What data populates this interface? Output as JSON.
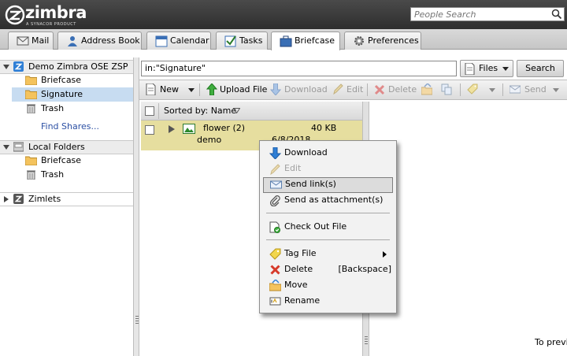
{
  "header": {
    "logo_word": "zimbra",
    "logo_sub": "A SYNACOR PRODUCT",
    "search_placeholder": "People Search"
  },
  "tabs": [
    {
      "label": "Mail",
      "icon": "mail-icon"
    },
    {
      "label": "Address Book",
      "icon": "address-book-icon"
    },
    {
      "label": "Calendar",
      "icon": "calendar-icon"
    },
    {
      "label": "Tasks",
      "icon": "tasks-icon"
    },
    {
      "label": "Briefcase",
      "icon": "briefcase-icon",
      "active": true
    },
    {
      "label": "Preferences",
      "icon": "gear-icon"
    }
  ],
  "sidebar": {
    "account": "Demo Zimbra OSE ZSP",
    "account_items": [
      "Briefcase",
      "Signature",
      "Trash"
    ],
    "selected": "Signature",
    "find_shares": "Find Shares...",
    "local_folders": "Local Folders",
    "local_items": [
      "Briefcase",
      "Trash"
    ],
    "zimlets": "Zimlets"
  },
  "search": {
    "query": "in:\"Signature\"",
    "scope": "Files",
    "button": "Search"
  },
  "toolbar": {
    "new": "New",
    "upload": "Upload File",
    "download": "Download",
    "edit": "Edit",
    "delete": "Delete",
    "send": "Send"
  },
  "list": {
    "sort_label": "Sorted by: Name",
    "rows": [
      {
        "name": "flower (2)",
        "size": "40 KB",
        "owner": "demo",
        "date": "6/8/2018"
      }
    ]
  },
  "preview_hint": "To previe",
  "context_menu": {
    "items": [
      {
        "label": "Download",
        "icon": "download-icon"
      },
      {
        "label": "Edit",
        "icon": "edit-icon",
        "disabled": true
      },
      {
        "label": "Send link(s)",
        "icon": "envelope-icon",
        "highlighted": true
      },
      {
        "label": "Send as attachment(s)",
        "icon": "paperclip-icon"
      },
      {
        "label": "Check Out File",
        "icon": "check-out-icon"
      },
      {
        "label": "Tag File",
        "icon": "tag-icon"
      },
      {
        "label": "Delete",
        "icon": "delete-icon",
        "shortcut": "[Backspace]"
      },
      {
        "label": "Move",
        "icon": "move-folder-icon"
      },
      {
        "label": "Rename",
        "icon": "rename-icon"
      }
    ]
  },
  "colors": {
    "header_bg": "#3a3a3a",
    "selection": "#c7dcf1",
    "row_highlight": "#e6de9f",
    "menu_bg": "#f2f2f2",
    "link": "#2b4fa3"
  }
}
